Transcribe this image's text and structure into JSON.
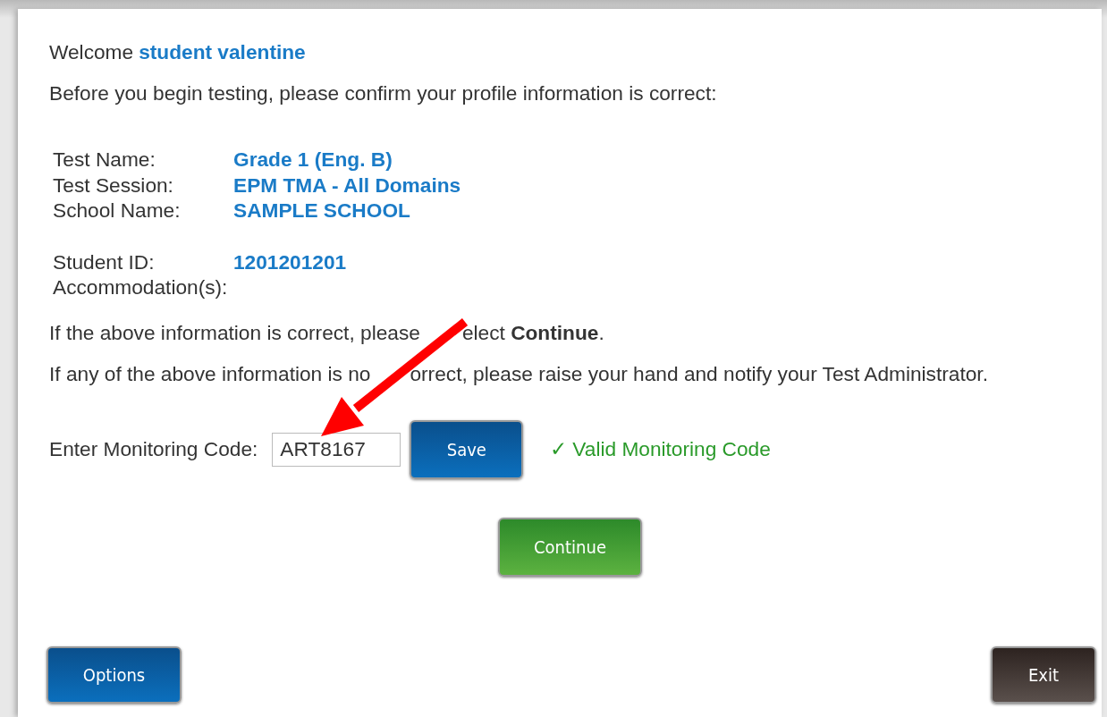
{
  "welcome": {
    "label": "Welcome",
    "name": "student valentine"
  },
  "intro": "Before you begin testing, please confirm your profile information is correct:",
  "profile_groups": [
    [
      {
        "label": "Test Name:",
        "value": "Grade 1 (Eng. B)"
      },
      {
        "label": "Test Session:",
        "value": "EPM TMA - All Domains"
      },
      {
        "label": "School Name:",
        "value": "SAMPLE SCHOOL"
      }
    ],
    [
      {
        "label": "Student ID:",
        "value": "1201201201"
      },
      {
        "label": "Accommodation(s):"
      }
    ]
  ],
  "notes": [
    {
      "parts": [
        "If the above information is correct, please",
        "elect **Continue**."
      ]
    },
    {
      "parts": [
        "If any of the above information is no",
        "orrect, please raise your hand and notify your Test Administrator."
      ]
    }
  ],
  "monitoring": {
    "label": "Enter Monitoring Code:",
    "value": "ART8167",
    "button": "Save",
    "status_icon": "✓",
    "status": "Valid Monitoring Code"
  },
  "continue_button": "Continue",
  "footer": {
    "left_button": "Options",
    "right_button": "Exit"
  },
  "annotation": {
    "kind": "arrow"
  }
}
